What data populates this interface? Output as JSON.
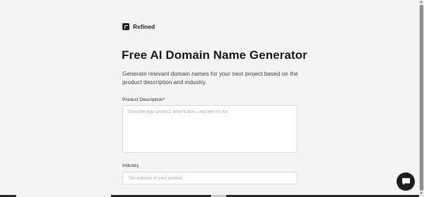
{
  "brand": {
    "name": "Refined",
    "icon": "refined-logo-icon"
  },
  "heading": "Free AI Domain Name Generator",
  "subheading": "Generate relevant domain names for your next project based on the product description and industry.",
  "form": {
    "description": {
      "label": "Product Description*",
      "placeholder": "Describe your product, what it does, and who it's for.",
      "value": ""
    },
    "industry": {
      "label": "Industry",
      "placeholder": "The industry of your product",
      "value": ""
    }
  },
  "chat": {
    "icon": "chat-bubble-icon"
  },
  "colors": {
    "background": "#f4f4f4",
    "text": "#1f2022",
    "chat_button": "#1c1c1e"
  }
}
